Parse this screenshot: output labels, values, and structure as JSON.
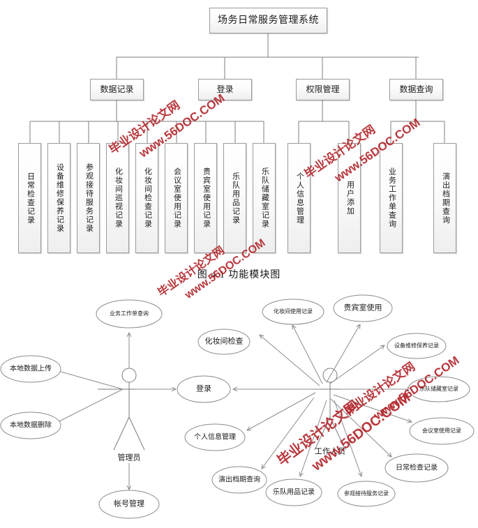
{
  "figure": {
    "caption": "图 4.1 功能模块图"
  },
  "module_tree": {
    "root": {
      "label": "场务日常服务管理系统"
    },
    "level2": [
      {
        "label": "数据记录"
      },
      {
        "label": "登录"
      },
      {
        "label": "权限管理"
      },
      {
        "label": "数据查询"
      }
    ],
    "leaves": [
      {
        "label": "日常检查记录",
        "parent": "数据记录"
      },
      {
        "label": "设备维修保养记录",
        "parent": "数据记录"
      },
      {
        "label": "参观接待服务记录",
        "parent": "数据记录"
      },
      {
        "label": "化妆间巡视记录",
        "parent": "数据记录"
      },
      {
        "label": "化妆间检查记录",
        "parent": "数据记录"
      },
      {
        "label": "会议室使用记录",
        "parent": "数据记录"
      },
      {
        "label": "贵宾室使用记录",
        "parent": "数据记录"
      },
      {
        "label": "乐队用品记录",
        "parent": "数据记录"
      },
      {
        "label": "乐队储藏室记录",
        "parent": "数据记录"
      },
      {
        "label": "个人信息管理",
        "parent": "权限管理"
      },
      {
        "label": "用户添加",
        "parent": "权限管理"
      },
      {
        "label": "业务工作单查询",
        "parent": "数据查询"
      },
      {
        "label": "演出档期查询",
        "parent": "数据查询"
      }
    ]
  },
  "use_case_diagram": {
    "actors": [
      {
        "label": "管理员"
      },
      {
        "label": "工作人员"
      }
    ],
    "use_cases": [
      {
        "label": "业务工作单查询"
      },
      {
        "label": "本地数据上传"
      },
      {
        "label": "本地数据删除"
      },
      {
        "label": "帐号管理"
      },
      {
        "label": "登录"
      },
      {
        "label": "化妆间检查"
      },
      {
        "label": "个人信息管理"
      },
      {
        "label": "演出档期查询"
      },
      {
        "label": "化妆间使用记录"
      },
      {
        "label": "贵宾室使用"
      },
      {
        "label": "设备维修保养记录"
      },
      {
        "label": "乐队储藏室记录"
      },
      {
        "label": "会议室使用记录"
      },
      {
        "label": "日常检查记录"
      },
      {
        "label": "乐队用品记录"
      },
      {
        "label": "参观接待服务记录"
      }
    ]
  },
  "watermark": {
    "line1": "毕业设计论文网",
    "line2": "www.56DOC.COM",
    "color": "#b3282d"
  }
}
